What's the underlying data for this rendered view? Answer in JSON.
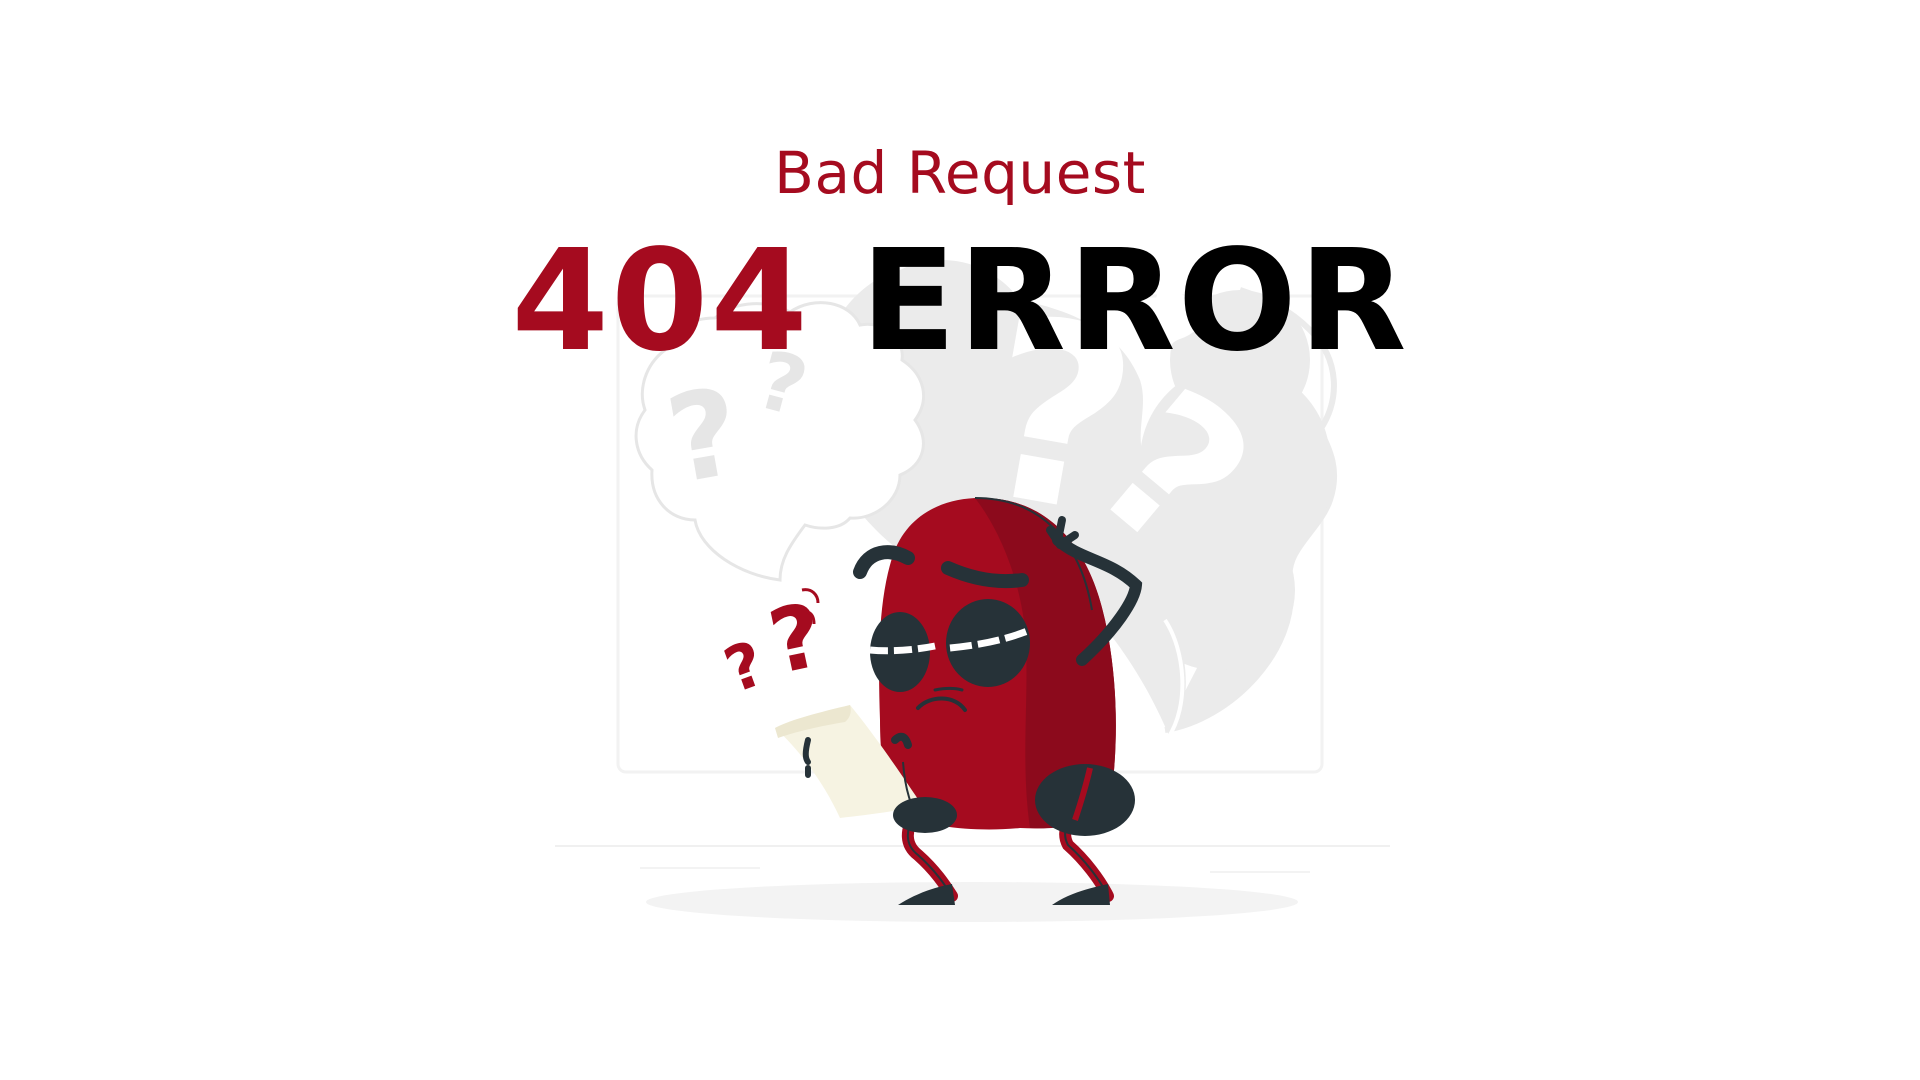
{
  "error": {
    "subtitle": "Bad Request",
    "code": "404",
    "label": "ERROR"
  },
  "illustration": {
    "glyph": "?",
    "icons": [
      "confused-bean-character-illustration",
      "thought-bubble-icon",
      "question-mark-icon",
      "paper-note-icon"
    ]
  },
  "colors": {
    "accent": "#a50b1f",
    "accent_dark": "#8c0a1c",
    "ink": "#263238",
    "ghost": "#ebebeb",
    "paper": "#f6f3e2"
  }
}
